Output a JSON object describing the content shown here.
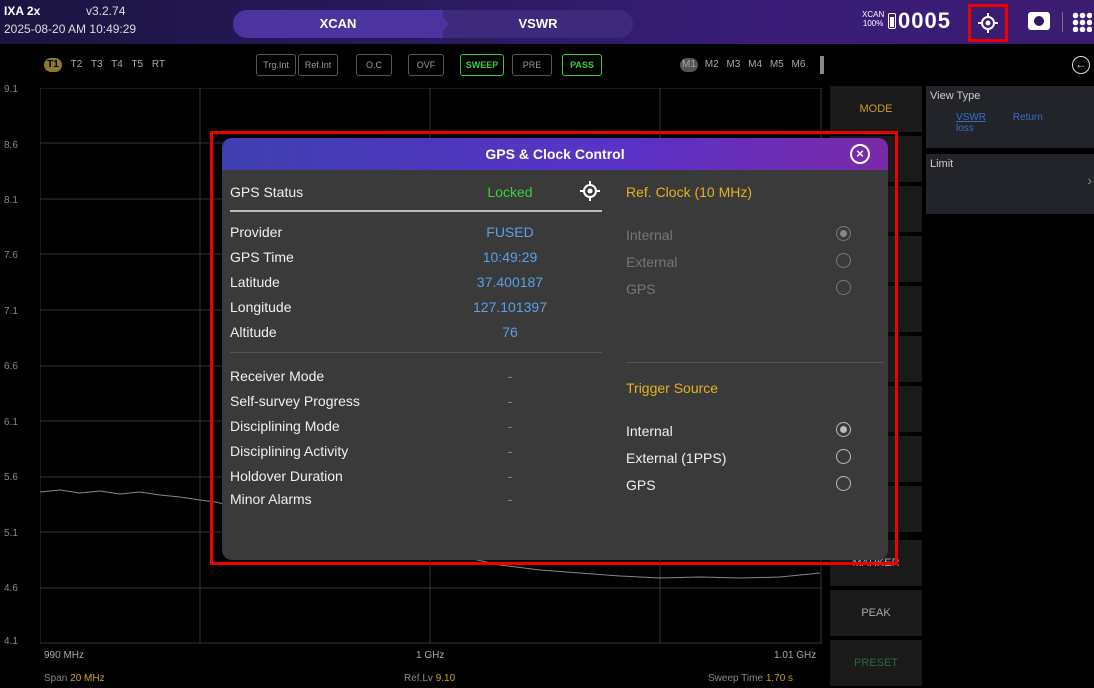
{
  "topbar": {
    "model": "IXA 2x",
    "version": "v3.2.74",
    "datetime": "2025-08-20 AM 10:49:29",
    "mode_left": "XCAN",
    "mode_right": "VSWR",
    "badge_line1": "XCAN",
    "badge_line2": "100%",
    "counter": "0005"
  },
  "traces": {
    "active": "T1",
    "others": [
      "T2",
      "T3",
      "T4",
      "T5",
      "RT"
    ]
  },
  "flags": [
    "Trg.Int",
    "Ref.Int",
    "O.C",
    "OVF",
    "SWEEP",
    "PRE",
    "PASS"
  ],
  "markers": {
    "active": "M1",
    "others": [
      "M2",
      "M3",
      "M4",
      "M5",
      "M6"
    ]
  },
  "plot": {
    "y_ticks": [
      "9.1",
      "8.6",
      "8.1",
      "7.6",
      "7.1",
      "6.6",
      "6.1",
      "5.6",
      "5.1",
      "4.6",
      "4.1"
    ],
    "x_start": "990 MHz",
    "x_center": "1 GHz",
    "x_end": "1.01 GHz",
    "span_label": "Span",
    "span_value": "20 MHz",
    "reflv_label": "Ref.Lv",
    "reflv_value": "9.10",
    "sweep_label": "Sweep Time",
    "sweep_value": "1.70 s"
  },
  "side_buttons": {
    "mode": "MODE",
    "marker": "MARKER",
    "peak": "PEAK",
    "preset": "PRESET"
  },
  "panel": {
    "view_type_title": "View Type",
    "view_type_selected": "VSWR",
    "view_type_other": "Return loss",
    "limit_title": "Limit",
    "limit_arrow": "›"
  },
  "modal": {
    "title": "GPS & Clock Control",
    "gps_status_label": "GPS Status",
    "gps_status_value": "Locked",
    "info": [
      {
        "label": "Provider",
        "value": "FUSED"
      },
      {
        "label": "GPS Time",
        "value": "10:49:29"
      },
      {
        "label": "Latitude",
        "value": "37.400187"
      },
      {
        "label": "Longitude",
        "value": "127.101397"
      },
      {
        "label": "Altitude",
        "value": "76"
      }
    ],
    "receiver": [
      {
        "label": "Receiver Mode",
        "value": "-"
      },
      {
        "label": "Self-survey Progress",
        "value": "-"
      },
      {
        "label": "Disciplining Mode",
        "value": "-"
      },
      {
        "label": "Disciplining Activity",
        "value": "-"
      },
      {
        "label": "Holdover Duration",
        "value": "-"
      },
      {
        "label": "Minor Alarms",
        "value": "-"
      }
    ],
    "ref_clock_title": "Ref. Clock (10 MHz)",
    "ref_clock_options": [
      "Internal",
      "External",
      "GPS"
    ],
    "trigger_title": "Trigger Source",
    "trigger_options": [
      "Internal",
      "External (1PPS)",
      "GPS"
    ]
  }
}
